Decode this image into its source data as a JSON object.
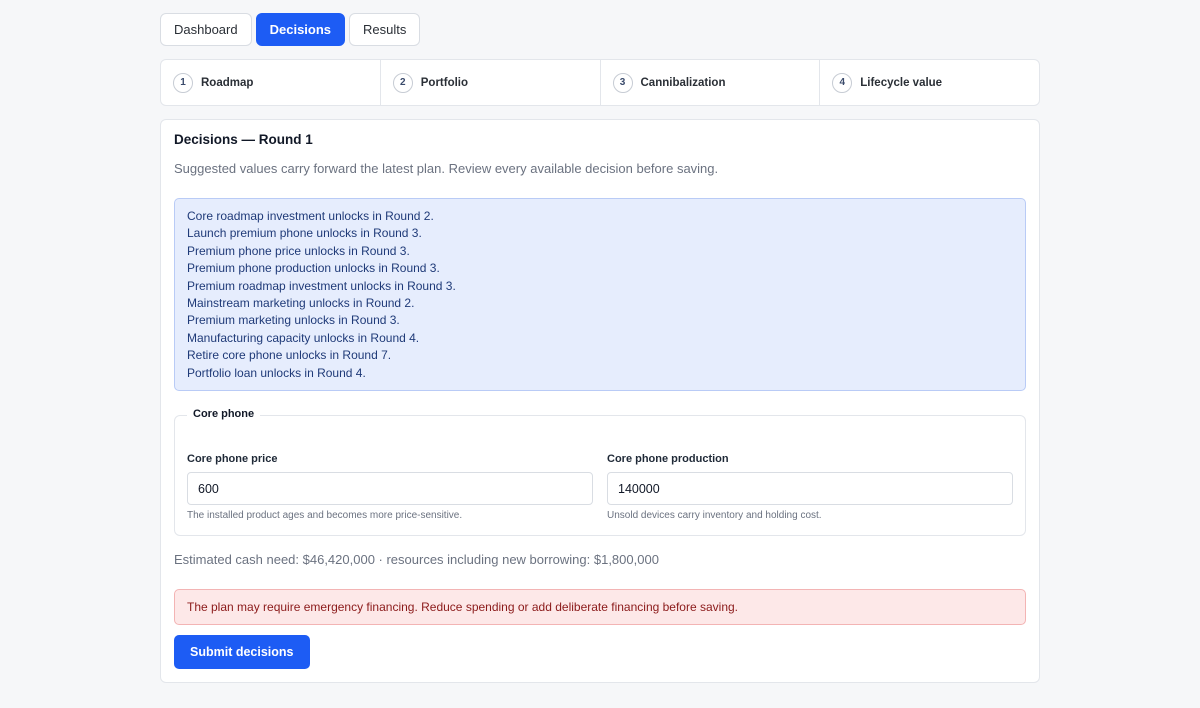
{
  "tabs": [
    {
      "label": "Dashboard",
      "active": false
    },
    {
      "label": "Decisions",
      "active": true
    },
    {
      "label": "Results",
      "active": false
    }
  ],
  "steps": [
    {
      "num": "1",
      "label": "Roadmap"
    },
    {
      "num": "2",
      "label": "Portfolio"
    },
    {
      "num": "3",
      "label": "Cannibalization"
    },
    {
      "num": "4",
      "label": "Lifecycle value"
    }
  ],
  "panel": {
    "title": "Decisions — Round 1",
    "subtitle": "Suggested values carry forward the latest plan. Review every available decision before saving."
  },
  "unlock_notes": [
    "Core roadmap investment unlocks in Round 2.",
    "Launch premium phone unlocks in Round 3.",
    "Premium phone price unlocks in Round 3.",
    "Premium phone production unlocks in Round 3.",
    "Premium roadmap investment unlocks in Round 3.",
    "Mainstream marketing unlocks in Round 2.",
    "Premium marketing unlocks in Round 3.",
    "Manufacturing capacity unlocks in Round 4.",
    "Retire core phone unlocks in Round 7.",
    "Portfolio loan unlocks in Round 4."
  ],
  "core_phone": {
    "legend": "Core phone",
    "price": {
      "label": "Core phone price",
      "value": "600",
      "help": "The installed product ages and becomes more price-sensitive."
    },
    "production": {
      "label": "Core phone production",
      "value": "140000",
      "help": "Unsold devices carry inventory and holding cost."
    }
  },
  "estimate": "Estimated cash need: $46,420,000 · resources including new borrowing: $1,800,000",
  "warning": "The plan may require emergency financing. Reduce spending or add deliberate financing before saving.",
  "submit_label": "Submit decisions",
  "colors": {
    "accent": "#1d5cf4",
    "info_bg": "#e6edfd",
    "warning_bg": "#fde8e8",
    "warning_text": "#8b1a1a"
  }
}
